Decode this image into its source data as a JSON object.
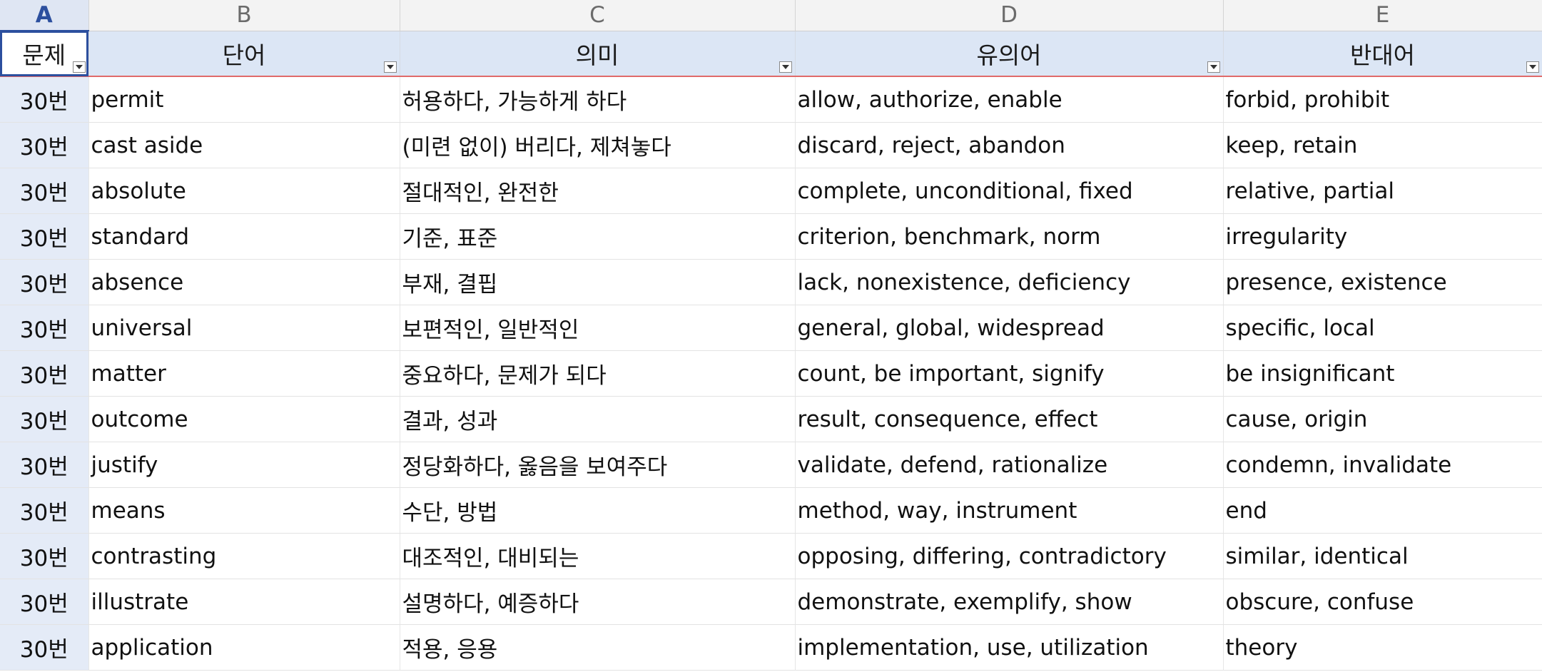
{
  "columns": [
    "A",
    "B",
    "C",
    "D",
    "E"
  ],
  "headers": {
    "problem": "문제",
    "word": "단어",
    "meaning": "의미",
    "synonyms": "유의어",
    "antonyms": "반대어"
  },
  "rows": [
    {
      "problem": "30번",
      "word": "permit",
      "meaning": "허용하다, 가능하게 하다",
      "synonyms": "allow, authorize, enable",
      "antonyms": "forbid, prohibit"
    },
    {
      "problem": "30번",
      "word": "cast aside",
      "meaning": "(미련 없이) 버리다, 제쳐놓다",
      "synonyms": "discard, reject, abandon",
      "antonyms": "keep, retain"
    },
    {
      "problem": "30번",
      "word": "absolute",
      "meaning": "절대적인, 완전한",
      "synonyms": "complete, unconditional, fixed",
      "antonyms": "relative, partial"
    },
    {
      "problem": "30번",
      "word": "standard",
      "meaning": "기준, 표준",
      "synonyms": "criterion, benchmark, norm",
      "antonyms": "irregularity"
    },
    {
      "problem": "30번",
      "word": "absence",
      "meaning": "부재, 결핍",
      "synonyms": "lack, nonexistence, deficiency",
      "antonyms": "presence, existence"
    },
    {
      "problem": "30번",
      "word": "universal",
      "meaning": "보편적인, 일반적인",
      "synonyms": "general, global, widespread",
      "antonyms": "specific, local"
    },
    {
      "problem": "30번",
      "word": "matter",
      "meaning": "중요하다, 문제가 되다",
      "synonyms": "count, be important, signify",
      "antonyms": "be insignificant"
    },
    {
      "problem": "30번",
      "word": "outcome",
      "meaning": "결과, 성과",
      "synonyms": "result, consequence, effect",
      "antonyms": "cause, origin"
    },
    {
      "problem": "30번",
      "word": "justify",
      "meaning": "정당화하다, 옳음을 보여주다",
      "synonyms": "validate, defend, rationalize",
      "antonyms": "condemn, invalidate"
    },
    {
      "problem": "30번",
      "word": "means",
      "meaning": "수단, 방법",
      "synonyms": "method, way, instrument",
      "antonyms": "end"
    },
    {
      "problem": "30번",
      "word": "contrasting",
      "meaning": "대조적인, 대비되는",
      "synonyms": "opposing, differing, contradictory",
      "antonyms": "similar, identical"
    },
    {
      "problem": "30번",
      "word": "illustrate",
      "meaning": "설명하다, 예증하다",
      "synonyms": "demonstrate, exemplify, show",
      "antonyms": "obscure, confuse"
    },
    {
      "problem": "30번",
      "word": "application",
      "meaning": "적용, 응용",
      "synonyms": "implementation, use, utilization",
      "antonyms": "theory"
    }
  ]
}
